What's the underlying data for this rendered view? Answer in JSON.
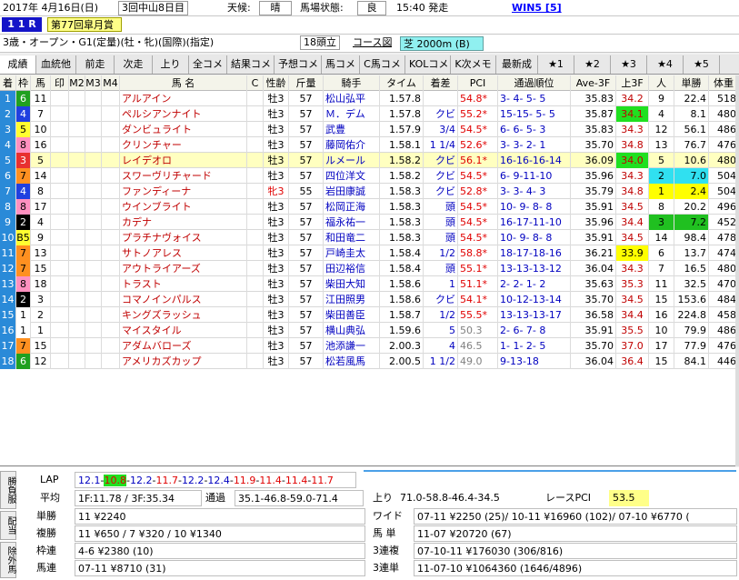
{
  "header": {
    "date": "2017年 4月16日(日)",
    "meeting": "3回中山8日目",
    "weather_label": "天候:",
    "weather": "晴",
    "track_label": "馬場状態:",
    "track": "良",
    "post_time": "15:40 発走",
    "win5": "WIN5 [5]",
    "race_no": "1 1 R",
    "race_name": "第77回皐月賞",
    "conditions": "3歳・オープン・G1(定量)(牡・牝)(国際)(指定)",
    "runners": "18頭立",
    "course_label": "コース図",
    "course": "芝 2000m (B)"
  },
  "tabs": [
    "成績",
    "血統他",
    "前走",
    "次走",
    "上り",
    "全コメ",
    "結果コメ",
    "予想コメ",
    "馬コメ",
    "C馬コメ",
    "KOLコメ",
    "K次メモ",
    "最新成",
    "★1",
    "★2",
    "★3",
    "★4",
    "★5"
  ],
  "columns": [
    "着",
    "枠",
    "馬",
    "印",
    "M2",
    "M3",
    "M4",
    "馬 名",
    "C",
    "性齢",
    "斤量",
    "騎手",
    "タイム",
    "着差",
    "PCI",
    "通過順位",
    "Ave-3F",
    "上3F",
    "人",
    "単勝",
    "体重"
  ],
  "rows": [
    [
      "1",
      "6",
      "11",
      "",
      "",
      "",
      "",
      "アルアイン",
      "",
      "牡3",
      "57",
      "松山弘平",
      "1.57.8",
      "",
      "54.8*",
      "3- 4- 5- 5",
      "35.83",
      "34.2",
      "9",
      "22.4",
      "518"
    ],
    [
      "2",
      "4",
      "7",
      "",
      "",
      "",
      "",
      "ペルシアンナイト",
      "",
      "牡3",
      "57",
      "Ｍ．デム",
      "1.57.8",
      "クビ",
      "55.2*",
      "15-15- 5- 5",
      "35.87",
      "34.1",
      "4",
      "8.1",
      "480"
    ],
    [
      "3",
      "5",
      "10",
      "",
      "",
      "",
      "",
      "ダンビュライト",
      "",
      "牡3",
      "57",
      "武豊",
      "1.57.9",
      "3/4",
      "54.5*",
      "6- 6- 5- 3",
      "35.83",
      "34.3",
      "12",
      "56.1",
      "486"
    ],
    [
      "4",
      "8",
      "16",
      "",
      "",
      "",
      "",
      "クリンチャー",
      "",
      "牡3",
      "57",
      "藤岡佑介",
      "1.58.1",
      "1 1/4",
      "52.6*",
      "3- 3- 2- 1",
      "35.70",
      "34.8",
      "13",
      "76.7",
      "476"
    ],
    [
      "5",
      "3",
      "5",
      "",
      "",
      "",
      "",
      "レイデオロ",
      "",
      "牡3",
      "57",
      "ルメール",
      "1.58.2",
      "クビ",
      "56.1*",
      "16-16-16-14",
      "36.09",
      "34.0",
      "5",
      "10.6",
      "480"
    ],
    [
      "6",
      "7",
      "14",
      "",
      "",
      "",
      "",
      "スワーヴリチャード",
      "",
      "牡3",
      "57",
      "四位洋文",
      "1.58.2",
      "クビ",
      "54.5*",
      "6- 9-11-10",
      "35.96",
      "34.3",
      "2",
      "7.0",
      "504"
    ],
    [
      "7",
      "4",
      "8",
      "",
      "",
      "",
      "",
      "ファンディーナ",
      "",
      "牝3",
      "55",
      "岩田康誠",
      "1.58.3",
      "クビ",
      "52.8*",
      "3- 3- 4- 3",
      "35.79",
      "34.8",
      "1",
      "2.4",
      "504"
    ],
    [
      "8",
      "8",
      "17",
      "",
      "",
      "",
      "",
      "ウインブライト",
      "",
      "牡3",
      "57",
      "松岡正海",
      "1.58.3",
      "頭",
      "54.5*",
      "10- 9- 8- 8",
      "35.91",
      "34.5",
      "8",
      "20.2",
      "496"
    ],
    [
      "9",
      "2",
      "4",
      "",
      "",
      "",
      "",
      "カデナ",
      "",
      "牡3",
      "57",
      "福永祐一",
      "1.58.3",
      "頭",
      "54.5*",
      "16-17-11-10",
      "35.96",
      "34.4",
      "3",
      "7.2",
      "452"
    ],
    [
      "10",
      "B5",
      "9",
      "",
      "",
      "",
      "",
      "プラチナヴォイス",
      "",
      "牡3",
      "57",
      "和田竜二",
      "1.58.3",
      "頭",
      "54.5*",
      "10- 9- 8- 8",
      "35.91",
      "34.5",
      "14",
      "98.4",
      "478"
    ],
    [
      "11",
      "7",
      "13",
      "",
      "",
      "",
      "",
      "サトノアレス",
      "",
      "牡3",
      "57",
      "戸崎圭太",
      "1.58.4",
      "1/2",
      "58.8*",
      "18-17-18-16",
      "36.21",
      "33.9",
      "6",
      "13.7",
      "474"
    ],
    [
      "12",
      "7",
      "15",
      "",
      "",
      "",
      "",
      "アウトライアーズ",
      "",
      "牡3",
      "57",
      "田辺裕信",
      "1.58.4",
      "頭",
      "55.1*",
      "13-13-13-12",
      "36.04",
      "34.3",
      "7",
      "16.5",
      "480"
    ],
    [
      "13",
      "8",
      "18",
      "",
      "",
      "",
      "",
      "トラスト",
      "",
      "牡3",
      "57",
      "柴田大知",
      "1.58.6",
      "1",
      "51.1*",
      "2- 2- 1- 2",
      "35.63",
      "35.3",
      "11",
      "32.5",
      "470"
    ],
    [
      "14",
      "2",
      "3",
      "",
      "",
      "",
      "",
      "コマノインパルス",
      "",
      "牡3",
      "57",
      "江田照男",
      "1.58.6",
      "クビ",
      "54.1*",
      "10-12-13-14",
      "35.70",
      "34.5",
      "15",
      "153.6",
      "484"
    ],
    [
      "15",
      "1",
      "2",
      "",
      "",
      "",
      "",
      "キングズラッシュ",
      "",
      "牡3",
      "57",
      "柴田善臣",
      "1.58.7",
      "1/2",
      "55.5*",
      "13-13-13-17",
      "36.58",
      "34.4",
      "16",
      "224.8",
      "458"
    ],
    [
      "16",
      "1",
      "1",
      "",
      "",
      "",
      "",
      "マイスタイル",
      "",
      "牡3",
      "57",
      "横山典弘",
      "1.59.6",
      "5",
      "50.3",
      "2- 6- 7- 8",
      "35.91",
      "35.5",
      "10",
      "79.9",
      "486"
    ],
    [
      "17",
      "7",
      "15",
      "",
      "",
      "",
      "",
      "アダムバローズ",
      "",
      "牡3",
      "57",
      "池添謙一",
      "2.00.3",
      "4",
      "46.5",
      "1- 1- 2- 5",
      "35.70",
      "37.0",
      "17",
      "77.9",
      "476"
    ],
    [
      "18",
      "6",
      "12",
      "",
      "",
      "",
      "",
      "アメリカズカップ",
      "",
      "牡3",
      "57",
      "松若風馬",
      "2.00.5",
      "1 1/2",
      "49.0",
      "9-13-18",
      "36.04",
      "36.4",
      "15",
      "84.1",
      "446"
    ]
  ],
  "bottom": {
    "lap_label": "LAP",
    "lap": [
      "12.1",
      "10.8",
      "12.2",
      "11.7",
      "12.2",
      "12.4",
      "11.9",
      "11.4",
      "11.4",
      "11.7"
    ],
    "avg_label": "平均",
    "avg": "1F:11.78 / 3F:35.34",
    "pass_label": "通過",
    "pass": "35.1-46.8-59.0-71.4",
    "up_label": "上り",
    "up": "71.0-58.8-46.4-34.5",
    "pci_label": "レースPCI",
    "pci": "53.5",
    "side_tabs": [
      "勝負服",
      "配当",
      "除外馬"
    ],
    "pay": [
      {
        "k": "単勝",
        "v": "11 ¥2240"
      },
      {
        "k": "複勝",
        "v": "11 ¥650 / 7 ¥320 / 10 ¥1340"
      },
      {
        "k": "枠連",
        "v": "4-6 ¥2380 (10)"
      },
      {
        "k": "馬連",
        "v": "07-11 ¥8710 (31)"
      }
    ],
    "pay2": [
      {
        "k": "ワイド",
        "v": "07-11 ¥2250 (25)/ 10-11 ¥16960 (102)/ 07-10 ¥6770 ("
      },
      {
        "k": "馬 単",
        "v": "11-07 ¥20720 (67)"
      },
      {
        "k": "3連複",
        "v": "07-10-11 ¥176030 (306/816)"
      },
      {
        "k": "3連単",
        "v": "11-07-10 ¥1064360 (1646/4896)"
      }
    ]
  }
}
